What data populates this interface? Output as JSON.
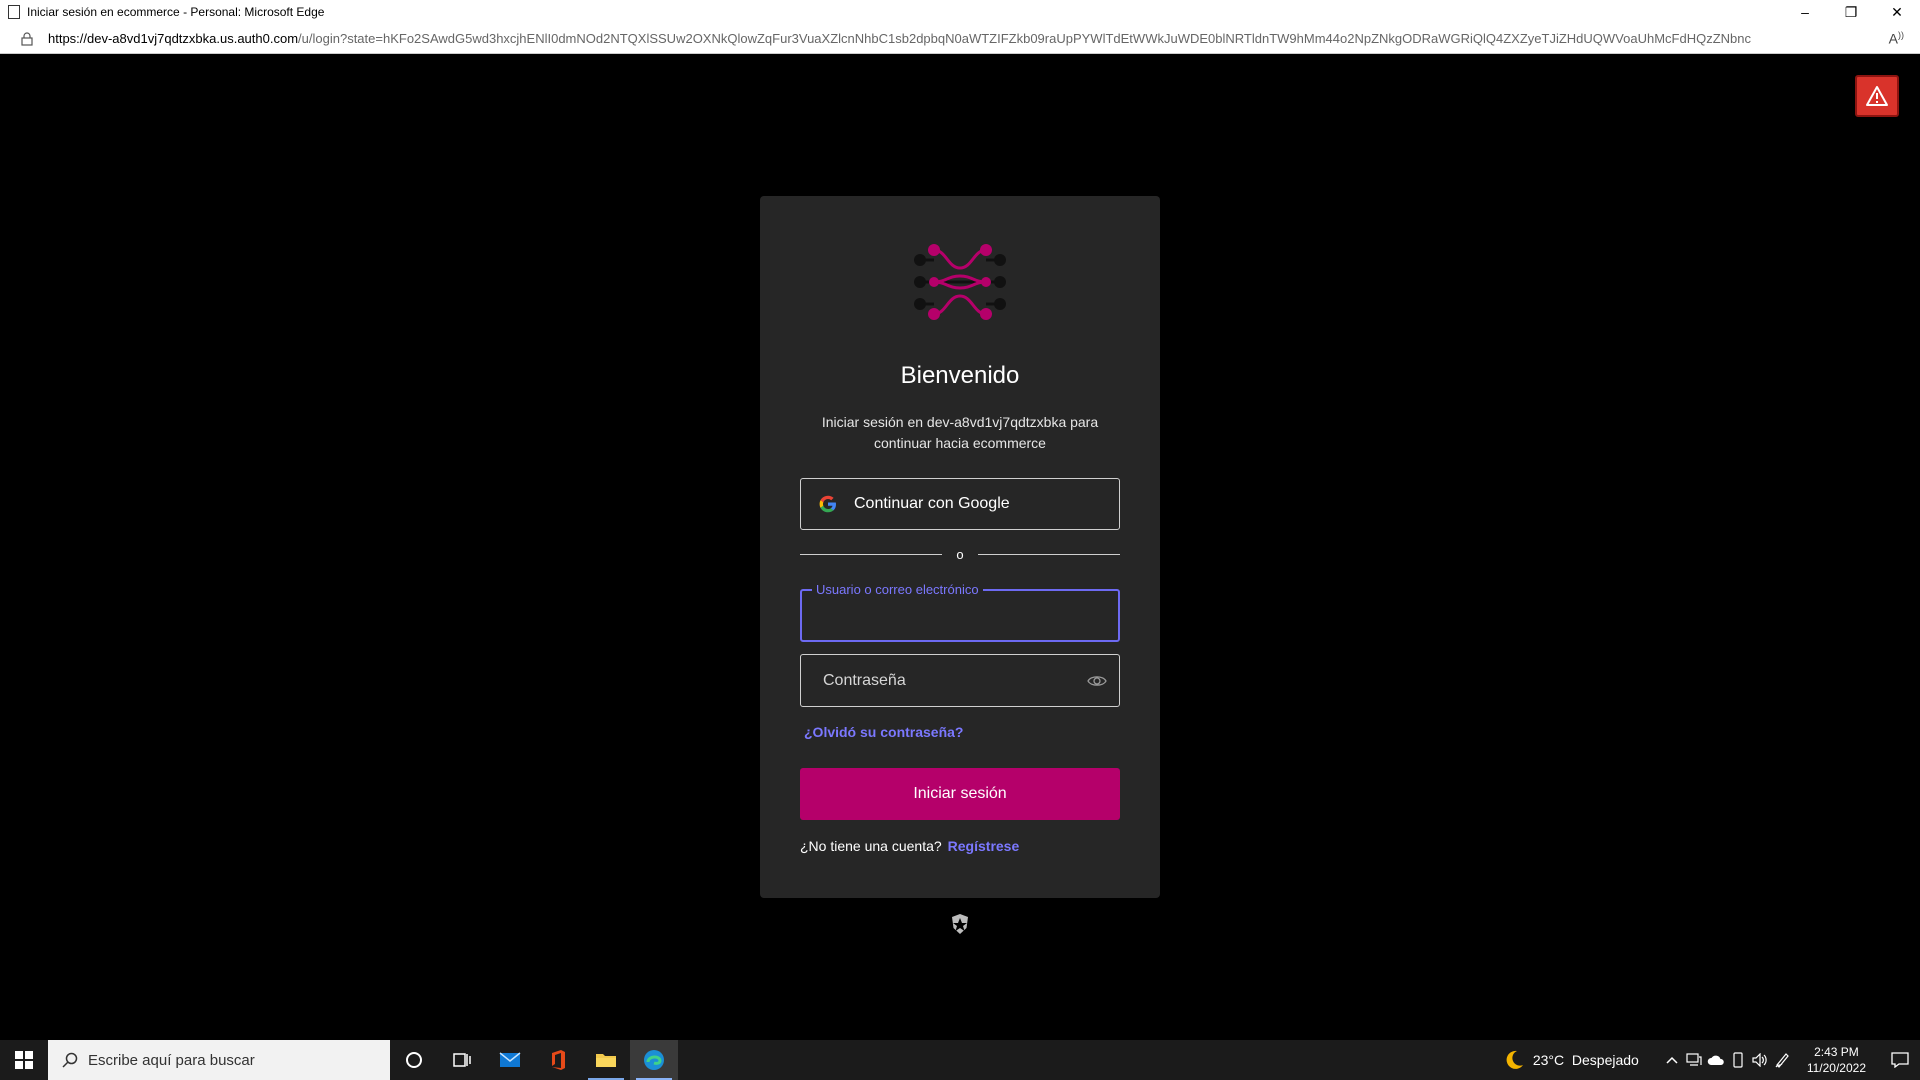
{
  "window": {
    "title": "Iniciar sesión en ecommerce - Personal: Microsoft Edge",
    "controls": {
      "minimize": "–",
      "restore": "❐",
      "close": "✕"
    }
  },
  "address_bar": {
    "url_host": "https://dev-a8vd1vj7qdtzxbka.us.auth0.com",
    "url_rest": "/u/login?state=hKFo2SAwdG5wd3hxcjhENlI0dmNOd2NTQXlSSUw2OXNkQlowZqFur3VuaXZlcnNhbC1sb2dpbqN0aWTZIFZkb09raUpPYWlTdEtWWkJuWDE0blNRTldnTW9hMm44o2NpZNkgODRaWGRiQlQ4ZXZyeTJiZHdUQWVoaUhMcFdHQzZNbnc",
    "read_aloud_icon": "read-aloud-icon"
  },
  "login": {
    "welcome": "Bienvenido",
    "subtitle": "Iniciar sesión en dev-a8vd1vj7qdtzxbka para continuar hacia ecommerce",
    "google_button": "Continuar con Google",
    "divider": "o",
    "username_label": "Usuario o correo electrónico",
    "username_value": "",
    "password_placeholder": "Contraseña",
    "forgot": "¿Olvidó su contraseña?",
    "submit": "Iniciar sesión",
    "signup_prompt": "¿No tiene una cuenta?",
    "signup_link": "Regístrese"
  },
  "taskbar": {
    "search_placeholder": "Escribe aquí para buscar",
    "weather_temp": "23°C",
    "weather_desc": "Despejado",
    "time": "2:43 PM",
    "date": "11/20/2022",
    "apps": [
      "cortana-icon",
      "task-view-icon",
      "mail-icon",
      "office-icon",
      "file-explorer-icon",
      "edge-icon"
    ]
  },
  "colors": {
    "accent_magenta": "#b5006a",
    "link_purple": "#7b78ff",
    "card_bg": "#262626",
    "alert_red": "#d9332b"
  }
}
